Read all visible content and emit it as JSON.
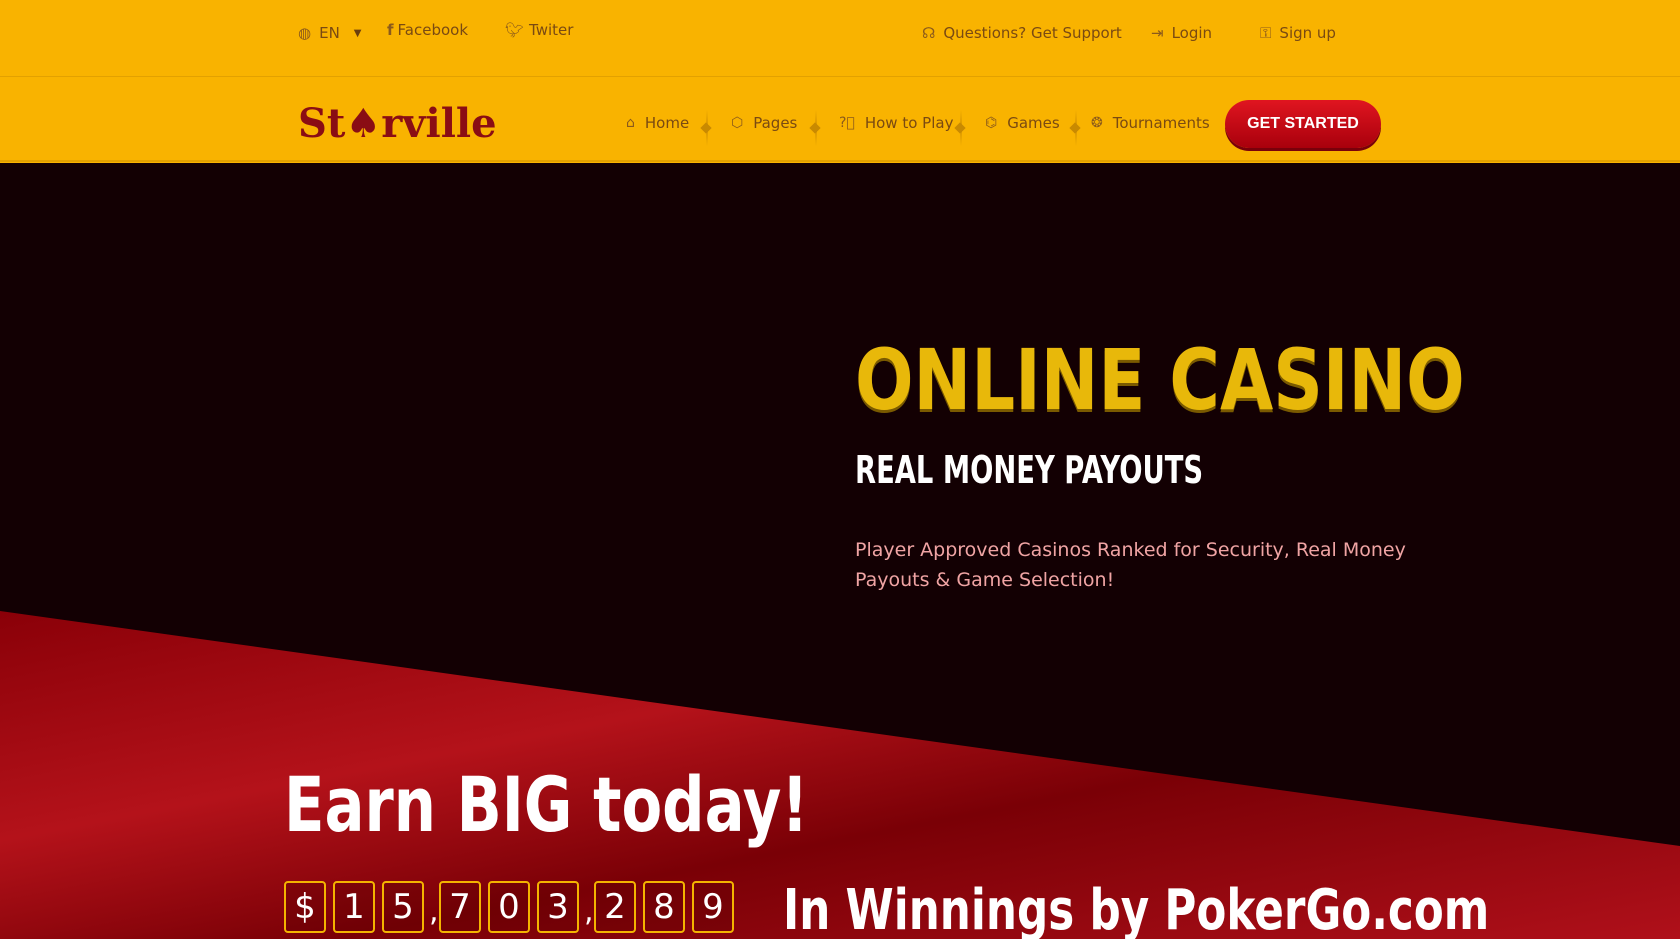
{
  "topbar": {
    "language": "EN",
    "facebook": "Facebook",
    "twitter": "Twiter",
    "support": "Questions? Get Support",
    "login": "Login",
    "signup": "Sign up"
  },
  "navbar": {
    "logo": "St♠rville",
    "items": [
      {
        "label": "Home",
        "icon": "home-icon"
      },
      {
        "label": "Pages",
        "icon": "cube-icon"
      },
      {
        "label": "How to Play",
        "icon": "help-icon"
      },
      {
        "label": "Games",
        "icon": "gamepad-icon"
      },
      {
        "label": "Tournaments",
        "icon": "award-icon"
      }
    ],
    "cta": "GET STARTED"
  },
  "hero": {
    "title": "ONLINE CASINO",
    "subtitle": "REAL MONEY PAYOUTS",
    "description": "Player Approved Casinos Ranked for Security, Real Money Payouts & Game Selection!",
    "earn": "Earn BIG today!",
    "counter": [
      "$",
      "1",
      "5",
      ",",
      "7",
      "0",
      "3",
      ",",
      "2",
      "8",
      "9"
    ],
    "winnings": "In Winnings by PokerGo.com"
  },
  "colors": {
    "accent": "#f9b300",
    "brand_red": "#8a0d14",
    "cta_red": "#e01520",
    "hero_dark": "#130003",
    "gold_text": "#e8b80a"
  }
}
